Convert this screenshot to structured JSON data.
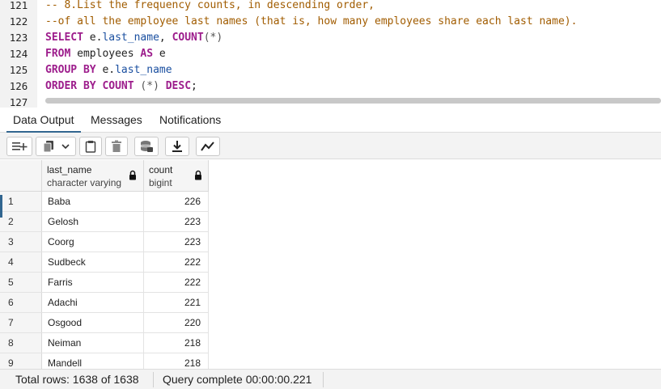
{
  "editor": {
    "lines": [
      {
        "n": "121",
        "tokens": [
          {
            "t": "-- 8.List the frequency counts, in descending order,",
            "c": "cm"
          }
        ]
      },
      {
        "n": "122",
        "tokens": [
          {
            "t": "--of all the employee last names (that is, how many employees share each last name).",
            "c": "cm"
          }
        ]
      },
      {
        "n": "123",
        "tokens": [
          {
            "t": "SELECT",
            "c": "kw"
          },
          {
            "t": " e.",
            "c": "id"
          },
          {
            "t": "last_name",
            "c": "fn"
          },
          {
            "t": ", ",
            "c": "id"
          },
          {
            "t": "COUNT",
            "c": "kw"
          },
          {
            "t": "(*)",
            "c": "pn"
          }
        ]
      },
      {
        "n": "124",
        "tokens": [
          {
            "t": "FROM",
            "c": "kw"
          },
          {
            "t": " employees ",
            "c": "id"
          },
          {
            "t": "AS",
            "c": "kw"
          },
          {
            "t": " e",
            "c": "id"
          }
        ]
      },
      {
        "n": "125",
        "tokens": [
          {
            "t": "GROUP BY",
            "c": "kw"
          },
          {
            "t": " e.",
            "c": "id"
          },
          {
            "t": "last_name",
            "c": "fn"
          }
        ]
      },
      {
        "n": "126",
        "tokens": [
          {
            "t": "ORDER BY",
            "c": "kw"
          },
          {
            "t": " ",
            "c": "id"
          },
          {
            "t": "COUNT",
            "c": "kw"
          },
          {
            "t": " (*) ",
            "c": "pn"
          },
          {
            "t": "DESC",
            "c": "kw"
          },
          {
            "t": ";",
            "c": "id"
          }
        ]
      },
      {
        "n": "127",
        "tokens": []
      }
    ]
  },
  "tabs": [
    {
      "label": "Data Output",
      "active": true
    },
    {
      "label": "Messages",
      "active": false
    },
    {
      "label": "Notifications",
      "active": false
    }
  ],
  "toolbar": {
    "icons": [
      "add-row-icon",
      "copy-icon",
      "dropdown-chevron-icon",
      "paste-icon",
      "delete-icon",
      "save-data-icon",
      "download-icon",
      "graph-icon"
    ]
  },
  "grid": {
    "columns": [
      {
        "name": "last_name",
        "type": "character varying"
      },
      {
        "name": "count",
        "type": "bigint"
      }
    ],
    "rows": [
      {
        "n": "1",
        "last_name": "Baba",
        "count": "226"
      },
      {
        "n": "2",
        "last_name": "Gelosh",
        "count": "223"
      },
      {
        "n": "3",
        "last_name": "Coorg",
        "count": "223"
      },
      {
        "n": "4",
        "last_name": "Sudbeck",
        "count": "222"
      },
      {
        "n": "5",
        "last_name": "Farris",
        "count": "222"
      },
      {
        "n": "6",
        "last_name": "Adachi",
        "count": "221"
      },
      {
        "n": "7",
        "last_name": "Osgood",
        "count": "220"
      },
      {
        "n": "8",
        "last_name": "Neiman",
        "count": "218"
      },
      {
        "n": "9",
        "last_name": "Mandell",
        "count": "218"
      }
    ]
  },
  "status": {
    "total_rows": "Total rows: 1638 of 1638",
    "query": "Query complete 00:00:00.221"
  },
  "colors": {
    "accent": "#326690",
    "keyword": "#9d1d8c",
    "comment": "#a15c00",
    "identifier": "#1a4fa0"
  }
}
